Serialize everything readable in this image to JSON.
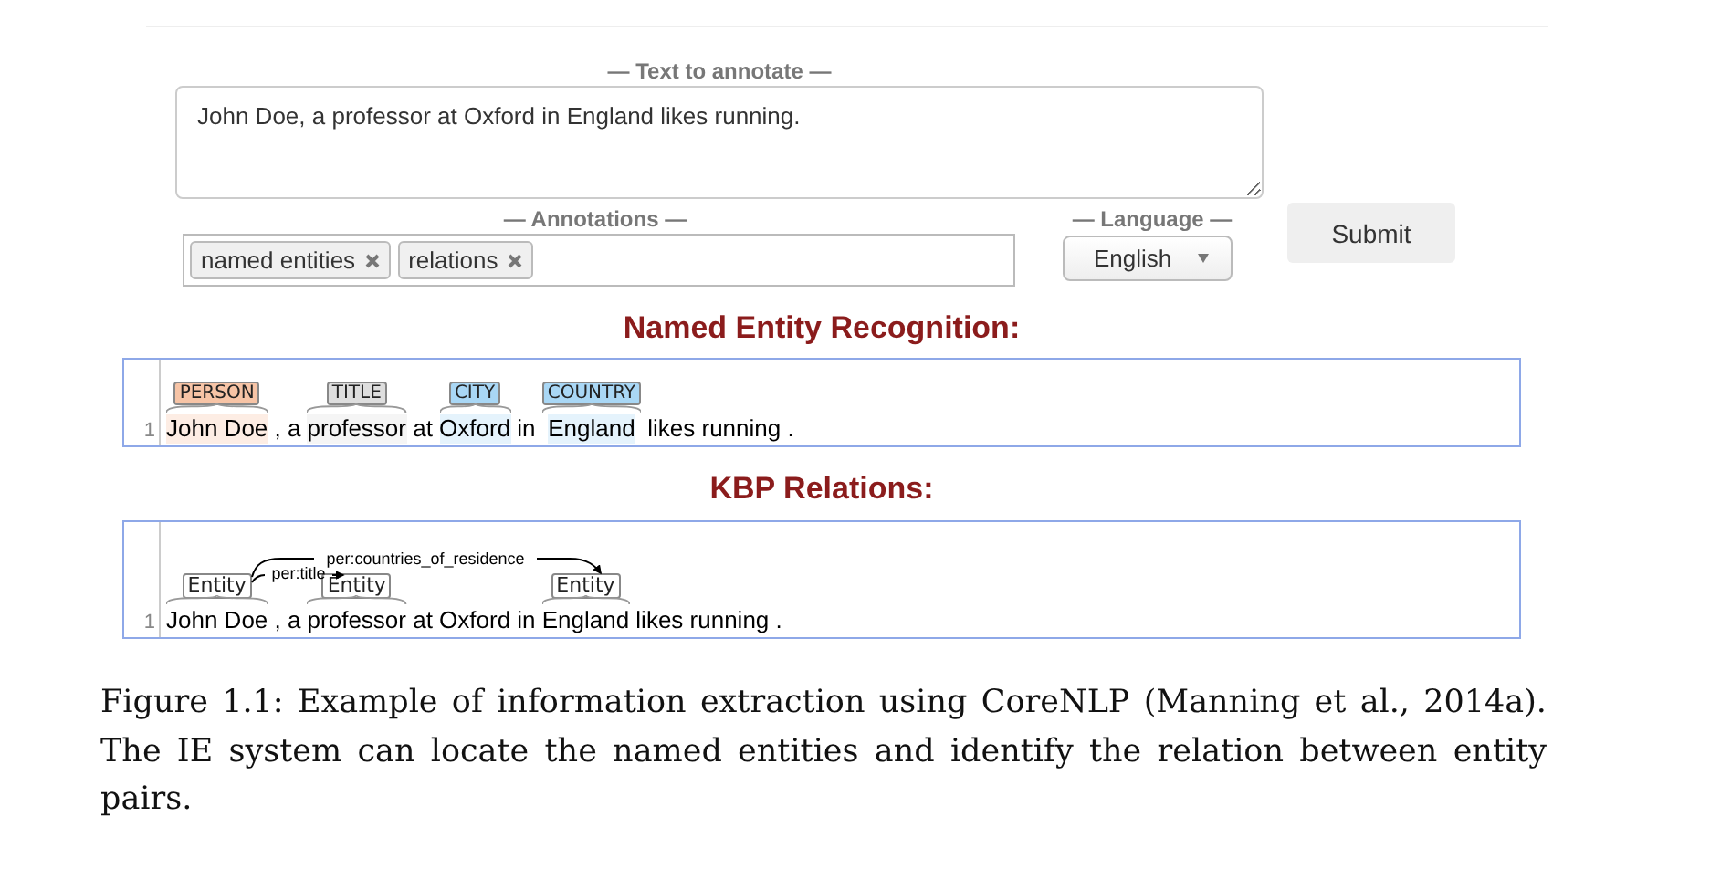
{
  "form": {
    "text_label": "— Text to annotate —",
    "text_value": "John Doe, a professor at Oxford in England likes running.",
    "annotations_label": "— Annotations —",
    "annotation_tags": [
      {
        "label": "named entities"
      },
      {
        "label": "relations"
      }
    ],
    "language_label": "— Language —",
    "language": "English",
    "submit": "Submit"
  },
  "ner": {
    "title": "Named Entity Recognition:",
    "line_number": "1",
    "tokens": [
      {
        "text": "John Doe",
        "label": "PERSON",
        "color": "#f7c4a6"
      },
      {
        "text": ","
      },
      {
        "text": "a"
      },
      {
        "text": "professor",
        "label": "TITLE",
        "color": "#dedede"
      },
      {
        "text": "at"
      },
      {
        "text": "Oxford",
        "label": "CITY",
        "color": "#a9d7f5"
      },
      {
        "text": "in"
      },
      {
        "text": "England",
        "label": "COUNTRY",
        "color": "#a9d7f5"
      },
      {
        "text": "likes"
      },
      {
        "text": "running"
      },
      {
        "text": "."
      }
    ]
  },
  "kbp": {
    "title": "KBP Relations:",
    "line_number": "1",
    "tokens": [
      {
        "text": "John Doe",
        "label": "Entity"
      },
      {
        "text": ","
      },
      {
        "text": "a"
      },
      {
        "text": "professor",
        "label": "Entity"
      },
      {
        "text": "at"
      },
      {
        "text": "Oxford"
      },
      {
        "text": "in"
      },
      {
        "text": "England",
        "label": "Entity"
      },
      {
        "text": "likes"
      },
      {
        "text": "running"
      },
      {
        "text": "."
      }
    ],
    "relations": [
      {
        "label": "per:countries_of_residence"
      },
      {
        "label": "per:title"
      }
    ]
  },
  "caption": "Figure 1.1: Example of information extraction using CoreNLP (Manning et al., 2014a). The IE system can locate the named entities and identify the relation between entity pairs."
}
